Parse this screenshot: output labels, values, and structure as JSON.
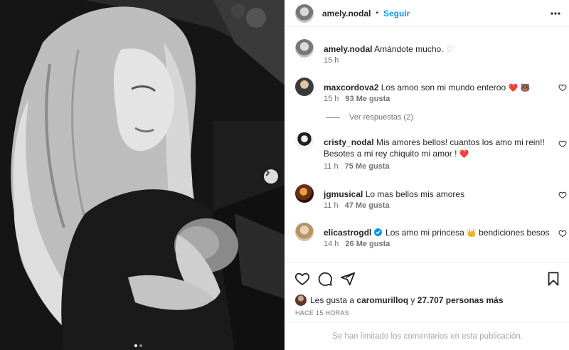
{
  "post": {
    "author": "amely.nodal",
    "follow_label": "Seguir",
    "separator": "•",
    "carousel": {
      "total": 2,
      "active": 1
    }
  },
  "caption": {
    "username": "amely.nodal",
    "text": "Amándote mucho.",
    "heart": "♡",
    "time": "15 h"
  },
  "comments": [
    {
      "username": "maxcordova2",
      "text": "Los amoo son mi mundo enteroo",
      "emoji": "❤️ 🐻",
      "time": "15 h",
      "likes": "93 Me gusta"
    },
    {
      "username": "cristy_nodal",
      "text": "Mis amores bellos! cuantos los amo mi rein!! Besotes a mi rey chiquito mi amor !",
      "emoji": "❤️",
      "time": "11 h",
      "likes": "75 Me gusta"
    },
    {
      "username": "jgmusical",
      "text": "Lo mas bellos mis amores",
      "emoji": "",
      "time": "11 h",
      "likes": "47 Me gusta"
    },
    {
      "username": "elicastrogdl",
      "text": "Los amo mi princesa",
      "emoji": "👑",
      "text2": "bendiciones besos",
      "time": "14 h",
      "likes": "26 Me gusta",
      "verified": true
    }
  ],
  "replies_label": "Ver respuestas (2)",
  "likes_summary": {
    "prefix": "Les gusta a",
    "user": "caromurilloq",
    "joiner": "y",
    "count_text": "27.707 personas más"
  },
  "post_time": "HACE 15 HORAS",
  "comments_limited": "Se han limitado los comentarios en esta publicación.",
  "colors": {
    "accent": "#0095f6",
    "text": "#262626",
    "muted": "#737373",
    "like": "#ed4956"
  },
  "icons": [
    "more-icon",
    "heart-icon",
    "comment-icon",
    "share-icon",
    "bookmark-icon",
    "chevron-right-icon",
    "verified-icon"
  ]
}
